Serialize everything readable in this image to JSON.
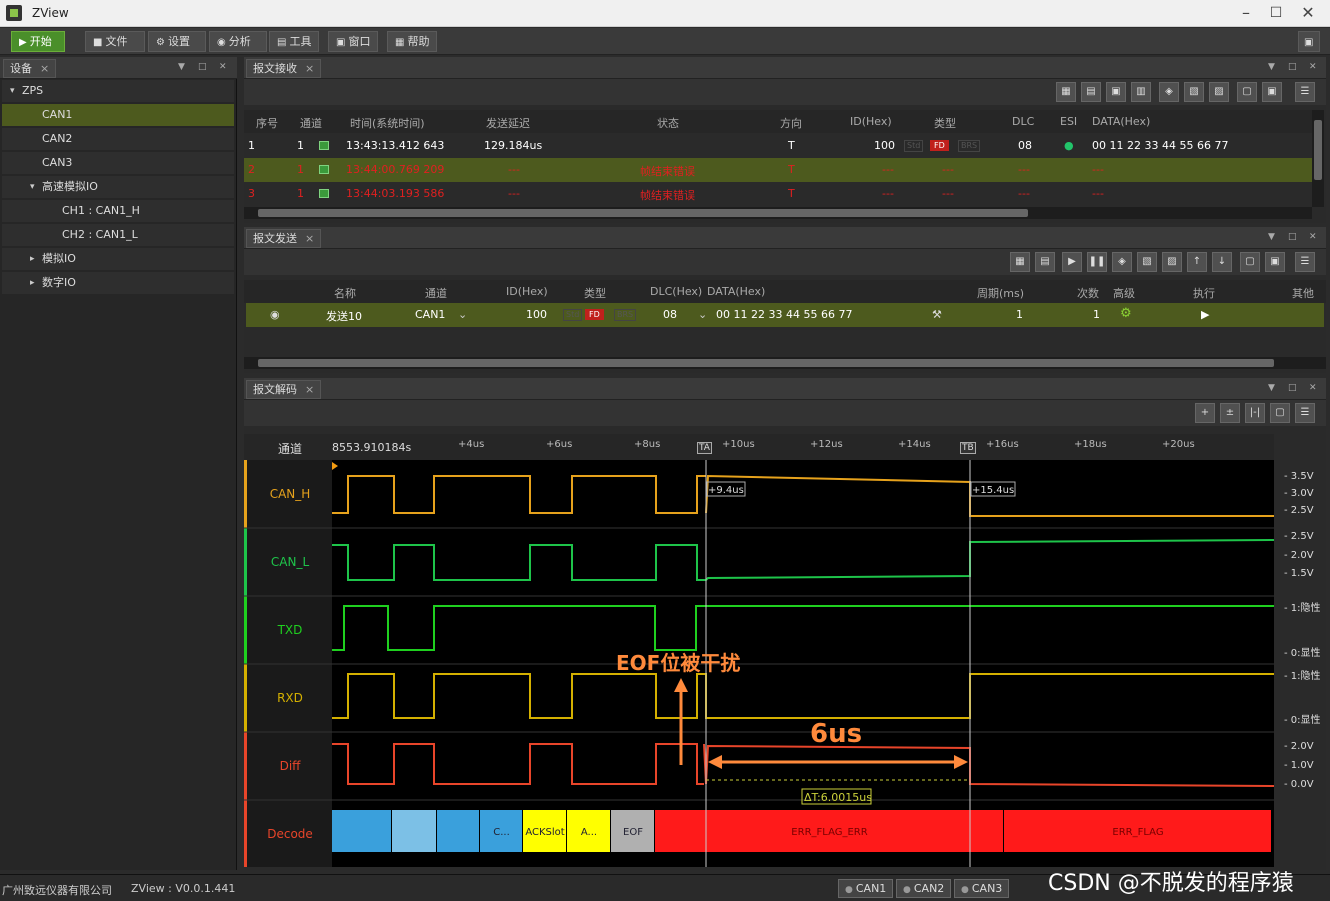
{
  "window": {
    "title": "ZView"
  },
  "toolbar": {
    "start": "开始",
    "file": "文件",
    "settings": "设置",
    "analyze": "分析",
    "tools": "工具",
    "window": "窗口",
    "help": "帮助"
  },
  "device_panel": {
    "tab": "设备",
    "tree": [
      {
        "label": "ZPS",
        "level": 0,
        "arrow": "▾"
      },
      {
        "label": "CAN1",
        "level": 1,
        "selected": true
      },
      {
        "label": "CAN2",
        "level": 1
      },
      {
        "label": "CAN3",
        "level": 1
      },
      {
        "label": "高速模拟IO",
        "level": 1,
        "arrow": "▾"
      },
      {
        "label": "CH1 : CAN1_H",
        "level": 2
      },
      {
        "label": "CH2 : CAN1_L",
        "level": 2
      },
      {
        "label": "模拟IO",
        "level": 1,
        "arrow": "▸"
      },
      {
        "label": "数字IO",
        "level": 1,
        "arrow": "▸"
      }
    ]
  },
  "receive": {
    "tab": "报文接收",
    "headers": [
      "序号",
      "通道",
      "时间(系统时间)",
      "发送延迟",
      "状态",
      "方向",
      "ID(Hex)",
      "类型",
      "DLC",
      "ESI",
      "DATA(Hex)"
    ],
    "rows": [
      {
        "no": "1",
        "ch": "1",
        "time": "13:43:13.412 643",
        "delay": "129.184us",
        "state": "",
        "dir": "T",
        "id": "100",
        "type": "FD",
        "dlc": "08",
        "data": "00 11 22 33 44 55 66 77",
        "err": false
      },
      {
        "no": "2",
        "ch": "1",
        "time": "13:44:00.769 209",
        "delay": "---",
        "state": "帧结束错误",
        "dir": "T",
        "id": "---",
        "type": "---",
        "dlc": "---",
        "data": "---",
        "err": true
      },
      {
        "no": "3",
        "ch": "1",
        "time": "13:44:03.193 586",
        "delay": "---",
        "state": "帧结束错误",
        "dir": "T",
        "id": "---",
        "type": "---",
        "dlc": "---",
        "data": "---",
        "err": true
      }
    ]
  },
  "send": {
    "tab": "报文发送",
    "headers": [
      "名称",
      "通道",
      "ID(Hex)",
      "类型",
      "DLC(Hex)",
      "DATA(Hex)",
      "周期(ms)",
      "次数",
      "高级",
      "执行",
      "其他"
    ],
    "row": {
      "name": "发送10",
      "ch": "CAN1",
      "id": "100",
      "type": "FD",
      "dlc": "08",
      "data": "00 11 22 33 44 55 66 77",
      "period": "1",
      "count": "1"
    }
  },
  "decode": {
    "tab": "报文解码",
    "channel_header": "通道",
    "t0": "8553.910184s",
    "ticks": [
      "+4us",
      "+6us",
      "+8us",
      "+10us",
      "+12us",
      "+14us",
      "+16us",
      "+18us",
      "+20us"
    ],
    "cursor_a": "TA",
    "cursor_b": "TB",
    "cursor_a_val": "+9.4us",
    "cursor_b_val": "+15.4us",
    "channels": [
      "CAN_H",
      "CAN_L",
      "TXD",
      "RXD",
      "Diff",
      "Decode"
    ],
    "scales": {
      "canh": [
        "3.5V",
        "3.0V",
        "2.5V"
      ],
      "canl": [
        "2.5V",
        "2.0V",
        "1.5V"
      ],
      "txd": [
        "1:隐性",
        "0:显性"
      ],
      "rxd": [
        "1:隐性",
        "0:显性"
      ],
      "diff": [
        "2.0V",
        "1.0V",
        "0.0V"
      ]
    },
    "annotation": "EOF位被干扰",
    "duration": "6us",
    "delta": "ΔT:6.0015us",
    "segments": [
      "C...",
      "ACKSlot",
      "A...",
      "EOF",
      "ERR_FLAG_ERR",
      "ERR_FLAG"
    ]
  },
  "status": {
    "company": "广州致远仪器有限公司",
    "version": "ZView : V0.0.1.441",
    "can": [
      "CAN1",
      "CAN2",
      "CAN3"
    ]
  },
  "watermark": "CSDN @不脱发的程序猿",
  "colors": {
    "canh": "#e6a21c",
    "canl": "#1ec44a",
    "txd": "#1fd01f",
    "rxd": "#d4b000",
    "diff": "#e8452a",
    "selrow": "#4d5a1e"
  }
}
